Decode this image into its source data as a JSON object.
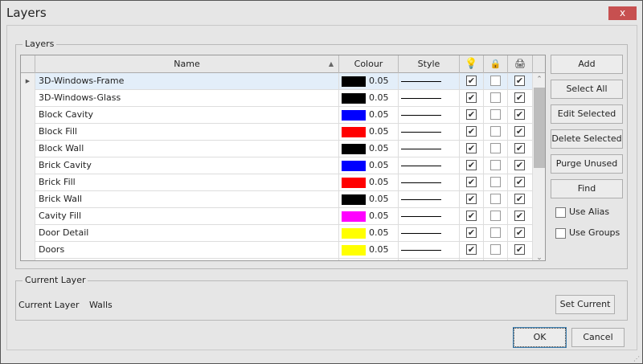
{
  "window": {
    "title": "Layers",
    "close_label": "x"
  },
  "layers_group": {
    "legend": "Layers"
  },
  "grid": {
    "columns": {
      "name": "Name",
      "colour": "Colour",
      "style": "Style"
    },
    "header_icons": [
      "lightbulb-icon",
      "lock-icon",
      "printer-icon"
    ],
    "rows": [
      {
        "name": "3D-Windows-Frame",
        "color": "#000000",
        "weight": "0.05",
        "on": true,
        "locked": false,
        "print": true
      },
      {
        "name": "3D-Windows-Glass",
        "color": "#000000",
        "weight": "0.05",
        "on": true,
        "locked": false,
        "print": true
      },
      {
        "name": "Block Cavity",
        "color": "#0000ff",
        "weight": "0.05",
        "on": true,
        "locked": false,
        "print": true
      },
      {
        "name": "Block Fill",
        "color": "#ff0000",
        "weight": "0.05",
        "on": true,
        "locked": false,
        "print": true
      },
      {
        "name": "Block Wall",
        "color": "#000000",
        "weight": "0.05",
        "on": true,
        "locked": false,
        "print": true
      },
      {
        "name": "Brick Cavity",
        "color": "#0000ff",
        "weight": "0.05",
        "on": true,
        "locked": false,
        "print": true
      },
      {
        "name": "Brick Fill",
        "color": "#ff0000",
        "weight": "0.05",
        "on": true,
        "locked": false,
        "print": true
      },
      {
        "name": "Brick Wall",
        "color": "#000000",
        "weight": "0.05",
        "on": true,
        "locked": false,
        "print": true
      },
      {
        "name": "Cavity Fill",
        "color": "#ff00ff",
        "weight": "0.05",
        "on": true,
        "locked": false,
        "print": true
      },
      {
        "name": "Door Detail",
        "color": "#ffff00",
        "weight": "0.05",
        "on": true,
        "locked": false,
        "print": true
      },
      {
        "name": "Doors",
        "color": "#ffff00",
        "weight": "0.05",
        "on": true,
        "locked": false,
        "print": true
      },
      {
        "name": "",
        "color": "#000000",
        "weight": "",
        "on": true,
        "locked": false,
        "print": true
      }
    ]
  },
  "buttons": {
    "add": "Add",
    "select_all": "Select All",
    "edit_selected": "Edit Selected",
    "delete_selected": "Delete Selected",
    "purge_unused": "Purge Unused",
    "find": "Find"
  },
  "options": {
    "use_alias": "Use Alias",
    "use_groups": "Use Groups"
  },
  "current_layer": {
    "legend": "Current Layer",
    "label": "Current Layer",
    "value": "Walls",
    "set_current": "Set Current"
  },
  "footer": {
    "ok": "OK",
    "cancel": "Cancel"
  }
}
